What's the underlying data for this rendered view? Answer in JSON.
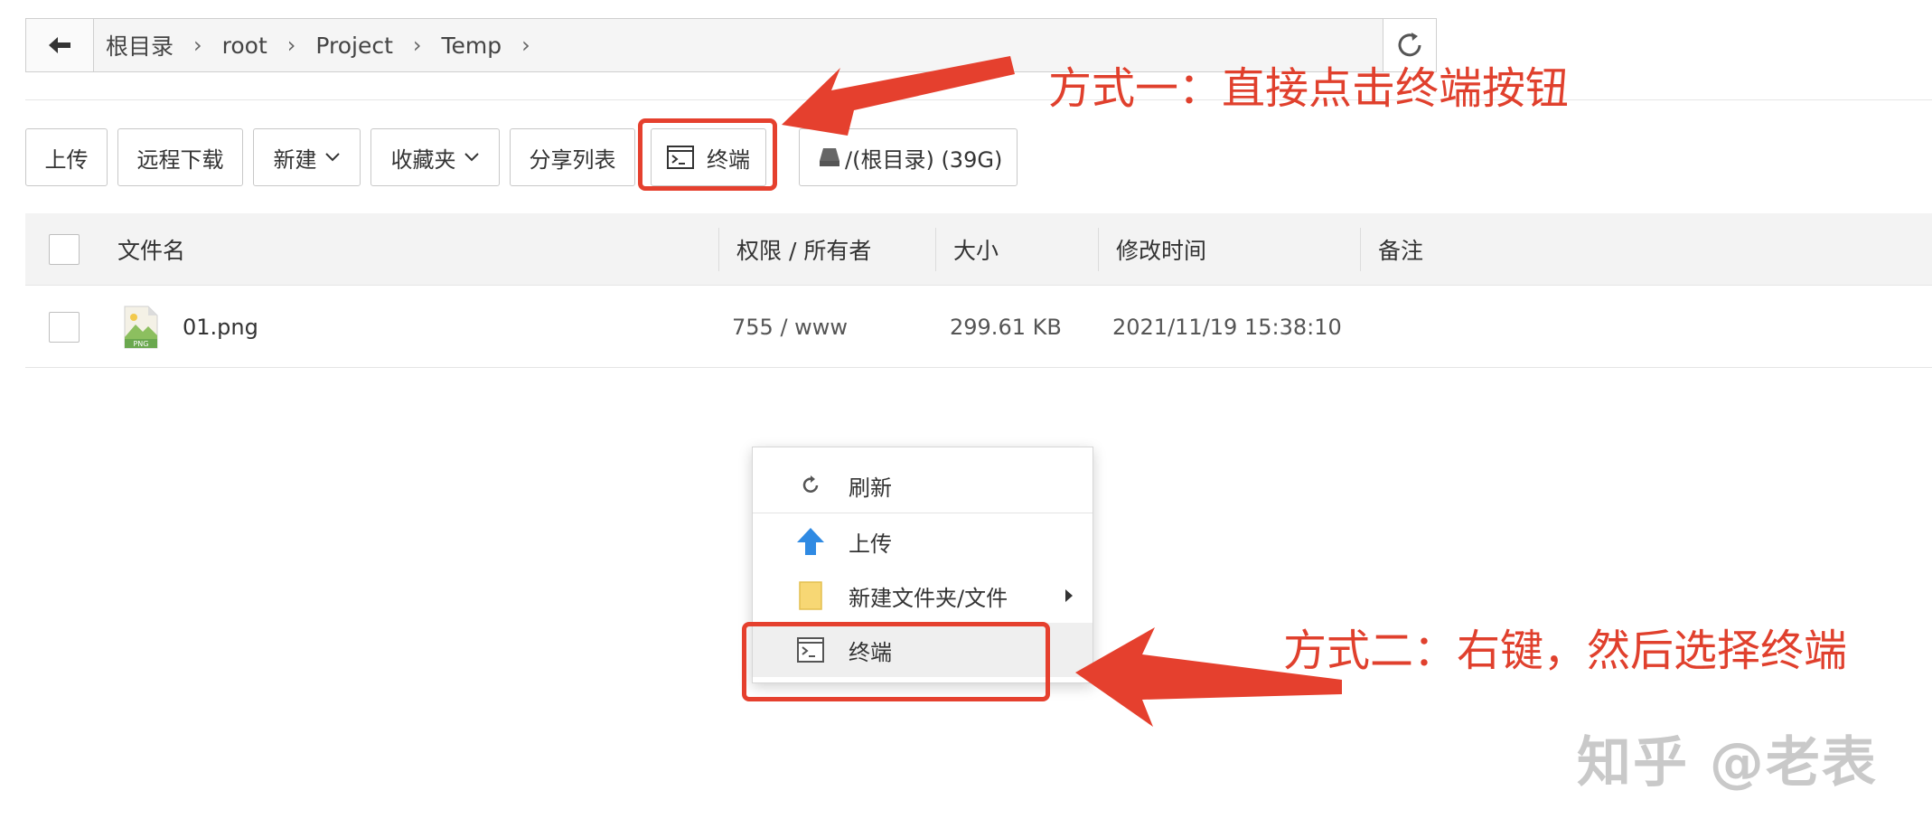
{
  "breadcrumb": {
    "items": [
      "根目录",
      "root",
      "Project",
      "Temp"
    ]
  },
  "toolbar": {
    "upload": "上传",
    "remote_download": "远程下载",
    "new": "新建",
    "favorites": "收藏夹",
    "share_list": "分享列表",
    "terminal": "终端",
    "disk": "/(根目录) (39G)"
  },
  "table": {
    "headers": [
      "文件名",
      "权限 / 所有者",
      "大小",
      "修改时间",
      "备注"
    ],
    "rows": [
      {
        "name": "01.png",
        "permission": "755 / www",
        "size": "299.61 KB",
        "modified": "2021/11/19 15:38:10",
        "note": "",
        "file_badge": "PNG"
      }
    ]
  },
  "context_menu": {
    "items": [
      "刷新",
      "上传",
      "新建文件夹/文件",
      "终端"
    ]
  },
  "annotations": {
    "method1": "方式一：直接点击终端按钮",
    "method2": "方式二：右键，然后选择终端"
  },
  "watermark": "知乎 @老表",
  "colors": {
    "annotation_red": "#e5402e",
    "upload_arrow_blue": "#2f8ae3",
    "folder_yellow": "#f7d774",
    "png_green": "#6aa84f"
  },
  "icons": [
    "back-arrow-icon",
    "refresh-icon",
    "terminal-icon",
    "disk-icon",
    "png-file-icon",
    "upload-arrow-icon",
    "folder-icon",
    "submenu-caret-icon"
  ]
}
